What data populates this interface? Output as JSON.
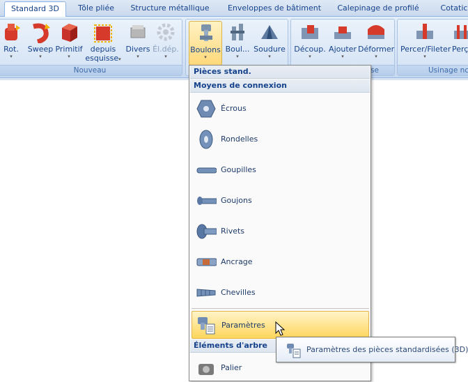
{
  "tabs": [
    {
      "label": "Standard 3D",
      "active": true
    },
    {
      "label": "Tôle pliée"
    },
    {
      "label": "Structure métallique"
    },
    {
      "label": "Enveloppes de bâtiment"
    },
    {
      "label": "Calepinage de profilé"
    },
    {
      "label": "Cotatic"
    }
  ],
  "ribbon": {
    "groups": [
      {
        "label": "Nouveau"
      },
      {
        "label": "se"
      },
      {
        "label": "Usinage nc"
      }
    ],
    "buttons": {
      "rot": "Rot.",
      "sweep": "Sweep",
      "primitif": "Primitif",
      "depuis": "depuis",
      "esquisse": "esquisse",
      "divers": "Divers",
      "eldep": "Él.dép.",
      "boulons": "Boulons",
      "boul": "Boul...",
      "soudure": "Soudure",
      "decoup": "Découp.",
      "ajouter": "Ajouter",
      "deformer": "Déformer",
      "percer": "Percer/Fileter",
      "perca": "Perça"
    },
    "arrow": "▾"
  },
  "menu": {
    "header1": "Pièces stand.",
    "header2": "Moyens de connexion",
    "items": [
      {
        "label": "Écrous",
        "icon": "nut-icon"
      },
      {
        "label": "Rondelles",
        "icon": "washer-icon"
      },
      {
        "label": "Goupilles",
        "icon": "pin-icon"
      },
      {
        "label": "Goujons",
        "icon": "stud-icon"
      },
      {
        "label": "Rivets",
        "icon": "rivet-icon"
      },
      {
        "label": "Ancrage",
        "icon": "anchor-icon"
      },
      {
        "label": "Chevilles",
        "icon": "dowel-icon"
      }
    ],
    "params": "Paramètres",
    "header3": "Éléments d'arbre",
    "palier": "Palier"
  },
  "tooltip": "Paramètres des pièces standardisées (3D)",
  "colors": {
    "accent": "#15428b",
    "highlight": "#ffd65c",
    "ribbon": "#d6e4f5"
  }
}
